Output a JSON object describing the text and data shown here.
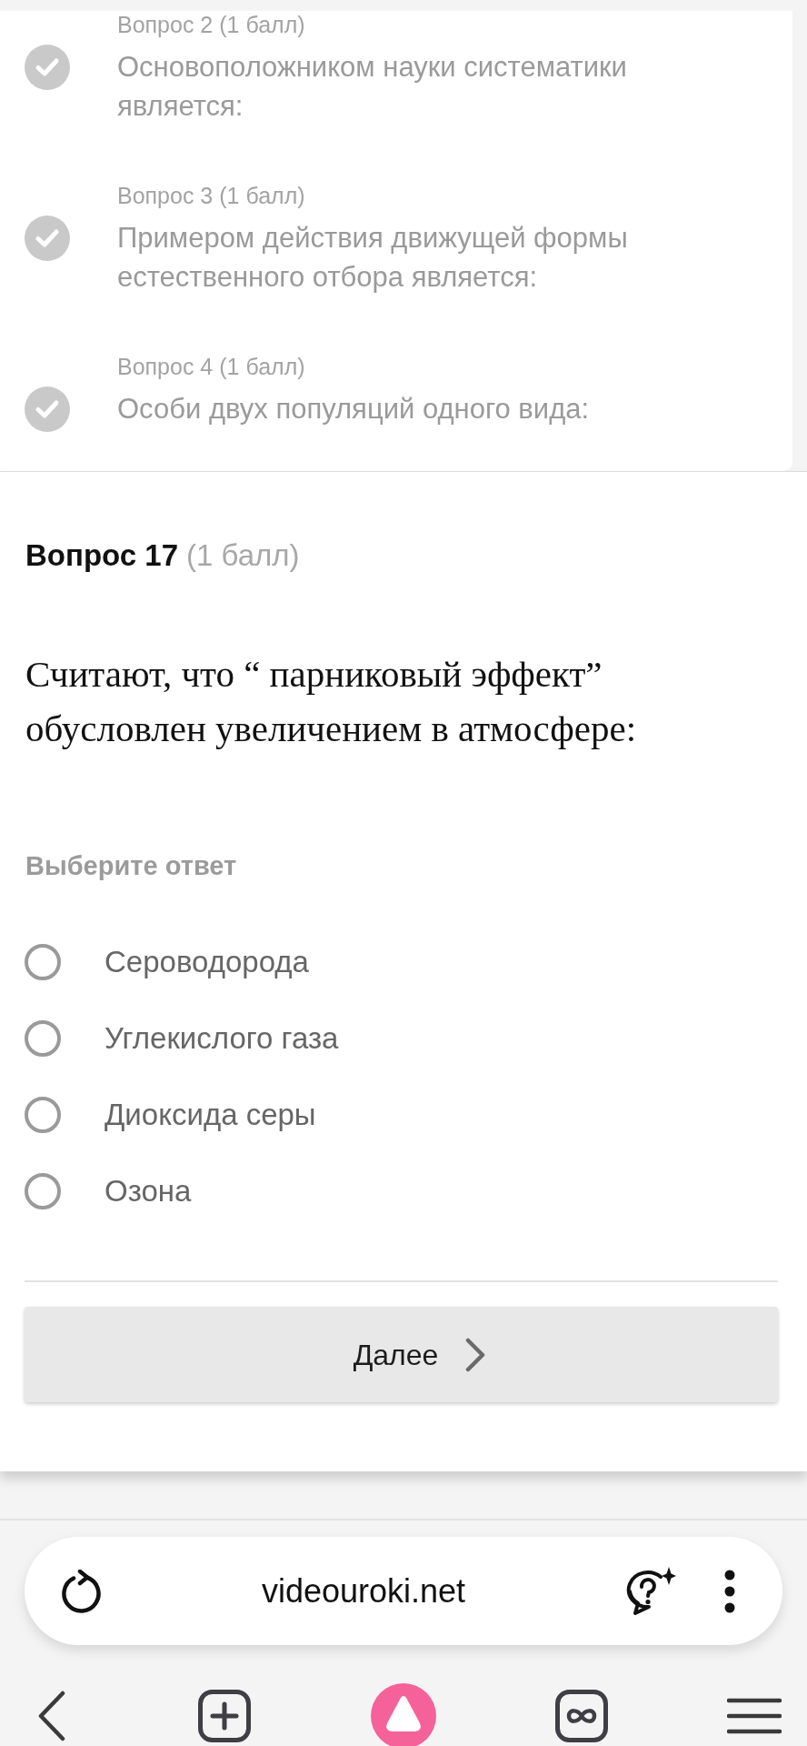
{
  "question_list": [
    {
      "label": "Вопрос 2 (1 балл)",
      "text": "Основоположником науки систематики является:",
      "answered": true
    },
    {
      "label": "Вопрос 3 (1 балл)",
      "text": "Примером действия движущей формы естественного отбора является:",
      "answered": true
    },
    {
      "label": "Вопрос 4 (1 балл)",
      "text": "Особи двух популяций одного вида:",
      "answered": true
    }
  ],
  "question": {
    "number": "Вопрос 17",
    "points": "(1 балл)",
    "text": "Считают, что “ парниковый эффект” обусловлен увеличением в атмосфере:",
    "prompt": "Выберите ответ",
    "options": [
      {
        "label": "Сероводорода",
        "selected": false
      },
      {
        "label": "Углекислого газа",
        "selected": false
      },
      {
        "label": "Диоксида серы",
        "selected": false
      },
      {
        "label": "Озона",
        "selected": false
      }
    ]
  },
  "next_button": "Далее",
  "browser": {
    "url": "videouroki.net"
  }
}
